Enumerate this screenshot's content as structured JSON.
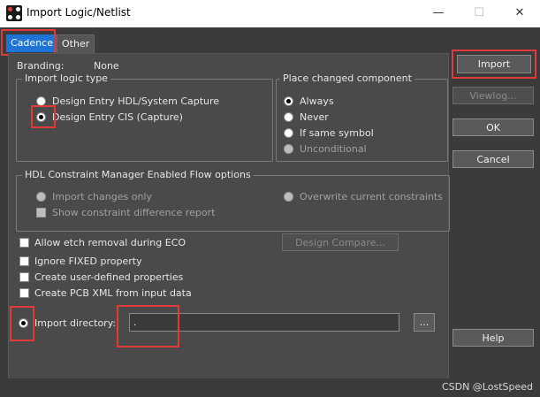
{
  "window": {
    "title": "Import Logic/Netlist",
    "minimize_glyph": "—",
    "maximize_glyph": "☐",
    "close_glyph": "✕"
  },
  "tabs": [
    {
      "label": "Cadence"
    },
    {
      "label": "Other"
    }
  ],
  "branding": {
    "label": "Branding:",
    "value": "None"
  },
  "import_logic_type": {
    "title": "Import logic type",
    "options": [
      {
        "label": "Design Entry HDL/System Capture",
        "selected": false
      },
      {
        "label": "Design Entry CIS (Capture)",
        "selected": true
      }
    ]
  },
  "place_changed": {
    "title": "Place changed component",
    "options": [
      {
        "label": "Always",
        "selected": true
      },
      {
        "label": "Never",
        "selected": false
      },
      {
        "label": "If same symbol",
        "selected": false
      },
      {
        "label": "Unconditional",
        "selected": false,
        "disabled": true
      }
    ]
  },
  "hdl_flow": {
    "title": "HDL Constraint Manager Enabled Flow options",
    "import_changes_only": "Import changes only",
    "overwrite": "Overwrite current constraints",
    "show_diff": "Show constraint difference report"
  },
  "checkboxes": [
    {
      "label": "Allow etch removal during ECO"
    },
    {
      "label": "Ignore FIXED property"
    },
    {
      "label": "Create user-defined properties"
    },
    {
      "label": "Create PCB XML from input data"
    }
  ],
  "design_compare_label": "Design Compare...",
  "import_directory": {
    "label": "Import directory:",
    "value": ".",
    "browse_label": "..."
  },
  "side_buttons": {
    "import": "Import",
    "viewlog": "Viewlog...",
    "ok": "OK",
    "cancel": "Cancel",
    "help": "Help"
  },
  "watermark": "CSDN @LostSpeed",
  "colors": {
    "active_tab": "#1e74d6",
    "highlight": "#e03b3b",
    "background": "#3b3b3b",
    "panel": "#4a4a4a"
  }
}
